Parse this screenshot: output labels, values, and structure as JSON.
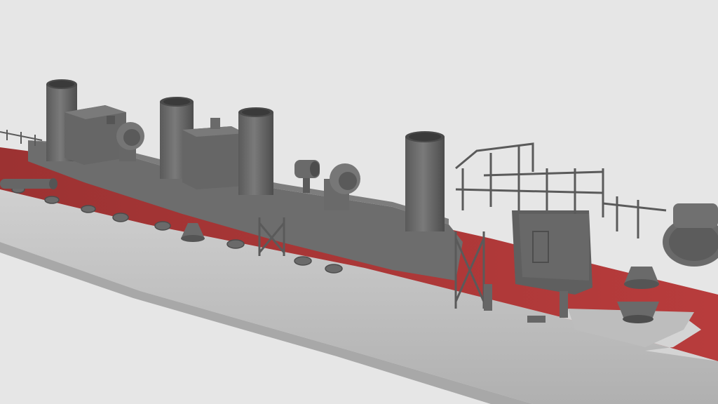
{
  "scene": {
    "subject": "ship-model-render",
    "colors": {
      "background": "#e6e6e6",
      "hull": "#c8c8c8",
      "hull_shadow": "#b4b4b4",
      "deck": "#b33a3a",
      "deck_dark": "#8f2c2c",
      "superstructure": "#6d6d6d",
      "superstructure_dark": "#575757",
      "superstructure_light": "#868686"
    }
  }
}
